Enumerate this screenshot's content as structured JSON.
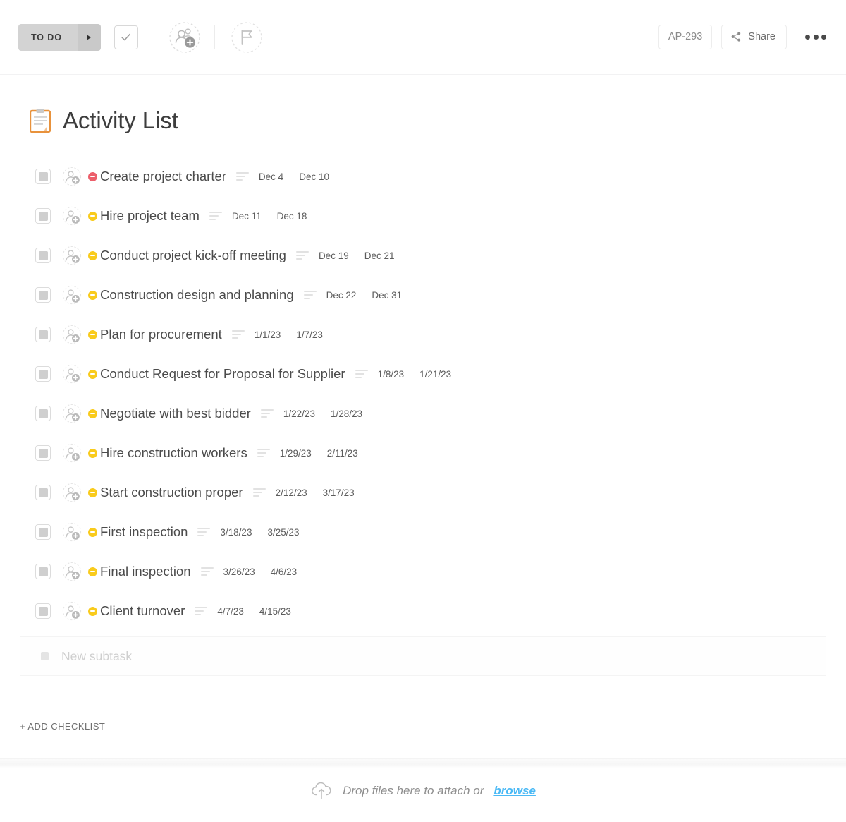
{
  "header": {
    "status_label": "TO DO",
    "status_arrow_icon": "caret-right-icon",
    "complete_icon": "checkmark-icon",
    "assignee_icon": "add-assignee-icon",
    "flag_icon": "flag-icon",
    "task_id": "AP-293",
    "share_label": "Share",
    "share_icon": "share-icon",
    "more_icon": "ellipsis-icon"
  },
  "title": {
    "emoji_icon": "clipboard-icon",
    "text": "Activity List"
  },
  "colors": {
    "priority_red": "#ec5f6b",
    "priority_yellow": "#f9cb1c",
    "link_blue": "#4ab9f5",
    "status_pill": "#d3d3d3",
    "clipboard_orange": "#e8923c"
  },
  "tasks": [
    {
      "name": "Create project charter",
      "priority": "red",
      "start": "Dec 4",
      "end": "Dec 10"
    },
    {
      "name": "Hire project team",
      "priority": "yellow",
      "start": "Dec 11",
      "end": "Dec 18"
    },
    {
      "name": "Conduct project kick-off meeting",
      "priority": "yellow",
      "start": "Dec 19",
      "end": "Dec 21"
    },
    {
      "name": "Construction design and planning",
      "priority": "yellow",
      "start": "Dec 22",
      "end": "Dec 31"
    },
    {
      "name": "Plan for procurement",
      "priority": "yellow",
      "start": "1/1/23",
      "end": "1/7/23"
    },
    {
      "name": "Conduct Request for Proposal for Supplier",
      "priority": "yellow",
      "start": "1/8/23",
      "end": "1/21/23"
    },
    {
      "name": "Negotiate with best bidder",
      "priority": "yellow",
      "start": "1/22/23",
      "end": "1/28/23"
    },
    {
      "name": "Hire construction workers",
      "priority": "yellow",
      "start": "1/29/23",
      "end": "2/11/23"
    },
    {
      "name": "Start construction proper",
      "priority": "yellow",
      "start": "2/12/23",
      "end": "3/17/23"
    },
    {
      "name": "First inspection",
      "priority": "yellow",
      "start": "3/18/23",
      "end": "3/25/23"
    },
    {
      "name": "Final inspection",
      "priority": "yellow",
      "start": "3/26/23",
      "end": "4/6/23"
    },
    {
      "name": "Client turnover",
      "priority": "yellow",
      "start": "4/7/23",
      "end": "4/15/23"
    }
  ],
  "new_subtask": {
    "placeholder": "New subtask"
  },
  "add_checklist": {
    "label": "+ ADD CHECKLIST"
  },
  "dropzone": {
    "icon": "cloud-upload-icon",
    "text": "Drop files here to attach or",
    "link_label": "browse"
  }
}
